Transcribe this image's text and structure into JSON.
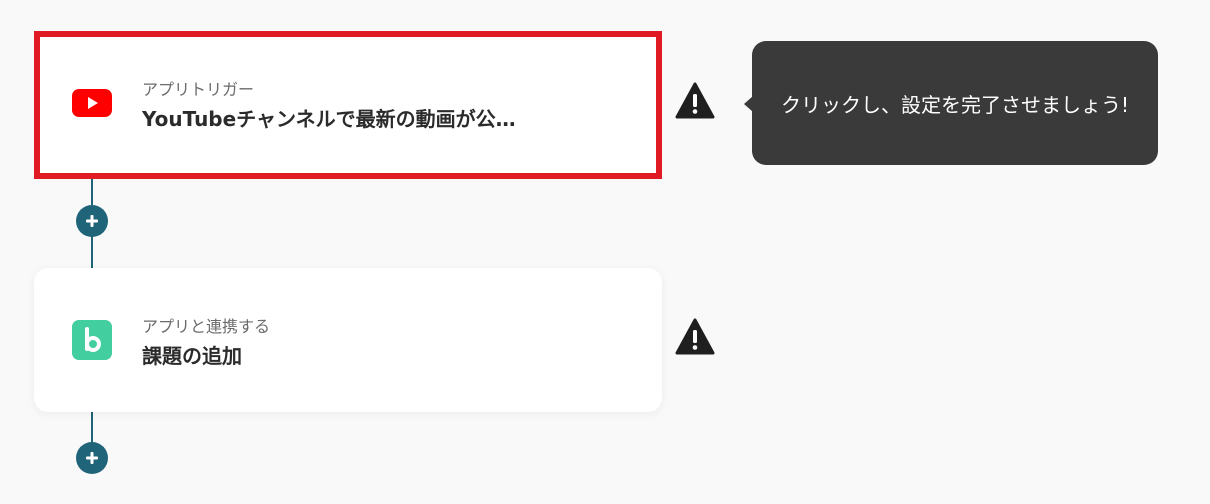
{
  "flow": {
    "steps": [
      {
        "kind_label": "アプリトリガー",
        "title": "YouTubeチャンネルで最新の動画が公…",
        "app_icon": "youtube-icon",
        "selected": true,
        "warning_icon": "warning-icon"
      },
      {
        "kind_label": "アプリと連携する",
        "title": "課題の追加",
        "app_icon": "backlog-icon",
        "selected": false,
        "warning_icon": "warning-icon"
      }
    ],
    "add_step_icon": "plus-icon"
  },
  "tooltip": {
    "text": "クリックし、設定を完了させましょう!"
  },
  "colors": {
    "background": "#f9f9f9",
    "connector": "#1f6478",
    "selected_border": "#e01b24",
    "youtube_red": "#ff0000",
    "backlog_green": "#42ce9f",
    "tooltip_bg": "#3a3a3a",
    "warning": "#1f1f1f"
  }
}
